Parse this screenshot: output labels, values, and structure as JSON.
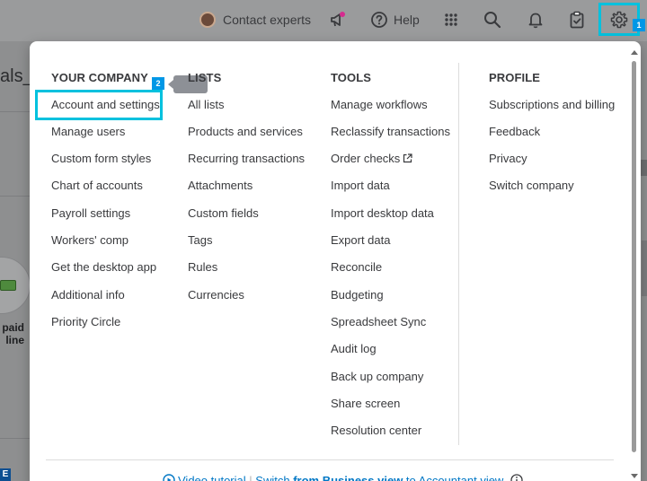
{
  "topbar": {
    "contact_label": "Contact experts",
    "help_label": "Help",
    "gear_badge": "1"
  },
  "background": {
    "title_fragment": "als_",
    "paid_line1": "paid",
    "paid_line2": "line",
    "badge_fragment": "E"
  },
  "menu": {
    "step_badge": "2",
    "columns": {
      "company": {
        "title": "YOUR COMPANY",
        "items": [
          "Account and settings",
          "Manage users",
          "Custom form styles",
          "Chart of accounts",
          "Payroll settings",
          "Workers' comp",
          "Get the desktop app",
          "Additional info",
          "Priority Circle"
        ]
      },
      "lists": {
        "title": "LISTS",
        "items": [
          "All lists",
          "Products and services",
          "Recurring transactions",
          "Attachments",
          "Custom fields",
          "Tags",
          "Rules",
          "Currencies"
        ]
      },
      "tools": {
        "title": "TOOLS",
        "items": [
          "Manage workflows",
          "Reclassify transactions",
          "Order checks",
          "Import data",
          "Import desktop data",
          "Export data",
          "Reconcile",
          "Budgeting",
          "Spreadsheet Sync",
          "Audit log",
          "Back up company",
          "Share screen",
          "Resolution center"
        ]
      },
      "profile": {
        "title": "PROFILE",
        "items": [
          "Subscriptions and billing",
          "Feedback",
          "Privacy",
          "Switch company"
        ]
      }
    },
    "footer": {
      "prefix": "Video tutorial",
      "link_start": "Switch ",
      "link_bold": "from Business view",
      "link_end": " to Accountant view"
    }
  },
  "colors": {
    "highlight": "#00c1de",
    "link": "#0077c5",
    "badge": "#0097e6"
  }
}
